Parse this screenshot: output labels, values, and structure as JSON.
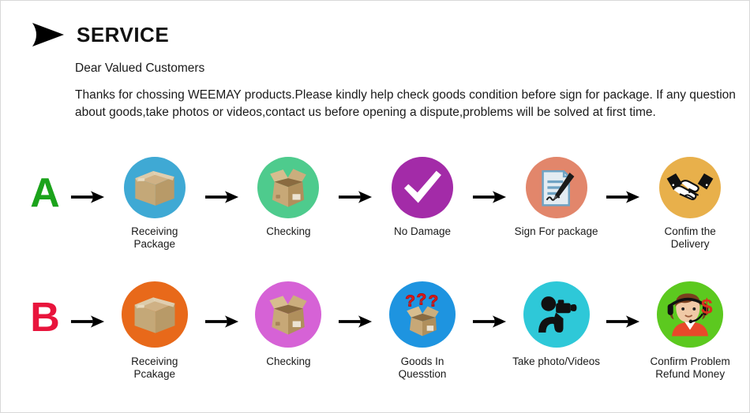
{
  "header": {
    "marker_icon": "right-triangle-marker",
    "title": "SERVICE",
    "salutation": "Dear Valued Customers",
    "body": "Thanks for chossing WEEMAY products.Please kindly help check goods condition before sign for package. If any question about goods,take photos or videos,contact us before opening a dispute,problems will be solved at first time."
  },
  "rows": [
    {
      "letter": "A",
      "letter_color": "#1ba31b",
      "steps": [
        {
          "label": "Receiving Package",
          "icon": "closed-box-icon",
          "circle_color": "#3fa9d4"
        },
        {
          "label": "Checking",
          "icon": "open-box-icon",
          "circle_color": "#4ecb8d"
        },
        {
          "label": "No Damage",
          "icon": "checkmark-icon",
          "circle_color": "#a32ba8"
        },
        {
          "label": "Sign For package",
          "icon": "document-pen-icon",
          "circle_color": "#e2866b"
        },
        {
          "label": "Confim the Delivery",
          "icon": "handshake-icon",
          "circle_color": "#e8b04b"
        }
      ]
    },
    {
      "letter": "B",
      "letter_color": "#e8143c",
      "steps": [
        {
          "label": "Receiving Pcakage",
          "icon": "closed-box-icon",
          "circle_color": "#e8691a"
        },
        {
          "label": "Checking",
          "icon": "open-box-icon",
          "circle_color": "#d662d6"
        },
        {
          "label": "Goods In Quesstion",
          "icon": "box-question-marks-icon",
          "circle_color": "#1e94e0"
        },
        {
          "label": "Take photo/Videos",
          "icon": "photographer-icon",
          "circle_color": "#2ec8d8"
        },
        {
          "label": "Confirm Problem\nRefund Money",
          "icon": "support-agent-dollar-icon",
          "circle_color": "#5cc91f"
        }
      ]
    }
  ],
  "arrow_icon": "right-arrow-icon"
}
